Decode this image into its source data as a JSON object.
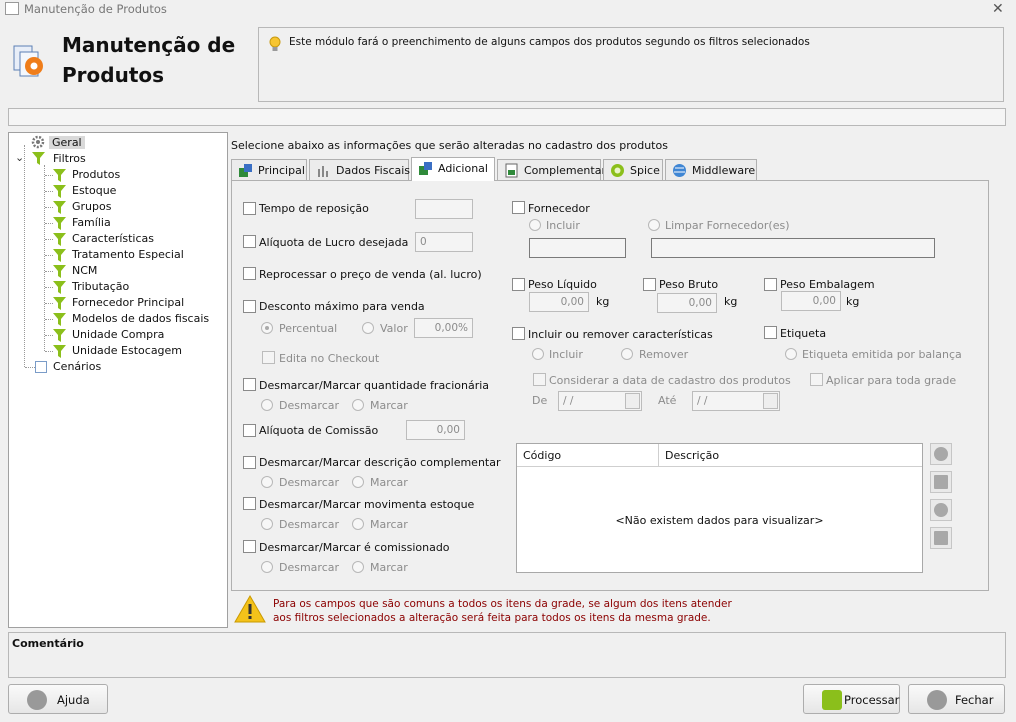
{
  "window": {
    "title": "Manutenção de Produtos",
    "close_glyph": "✕"
  },
  "header": {
    "title_line1": "Manutenção de",
    "title_line2": "Produtos",
    "info": "Este módulo fará o preenchimento de alguns campos dos produtos segundo os filtros selecionados"
  },
  "tree": {
    "root": "Geral",
    "filters_label": "Filtros",
    "filters": [
      "Produtos",
      "Estoque",
      "Grupos",
      "Família",
      "Características",
      "Tratamento Especial",
      "NCM",
      "Tributação",
      "Fornecedor Principal",
      "Modelos de dados fiscais",
      "Unidade Compra",
      "Unidade Estocagem"
    ],
    "scenarios": "Cenários"
  },
  "main": {
    "caption": "Selecione abaixo as informações que serão alteradas no cadastro dos produtos",
    "tabs": [
      {
        "label": "Principal"
      },
      {
        "label": "Dados Fiscais"
      },
      {
        "label": "Adicional"
      },
      {
        "label": "Complementar"
      },
      {
        "label": "Spice"
      },
      {
        "label": "Middleware"
      }
    ],
    "active_tab": "Adicional"
  },
  "left_form": {
    "tempo_reposicao": "Tempo de reposição",
    "tempo_reposicao_value": "",
    "aliquota_lucro": "Alíquota de Lucro desejada",
    "aliquota_lucro_value": "0",
    "reprocessar": "Reprocessar o preço de venda (al. lucro)",
    "desconto": "Desconto máximo para venda",
    "percentual": "Percentual",
    "valor": "Valor",
    "desconto_value": "0,00%",
    "edita_checkout": "Edita no Checkout",
    "qtd_fracionaria": "Desmarcar/Marcar quantidade fracionária",
    "desmarcar": "Desmarcar",
    "marcar": "Marcar",
    "aliquota_comissao": "Alíquota de Comissão",
    "aliquota_comissao_value": "0,00",
    "descricao_complementar": "Desmarcar/Marcar descrição complementar",
    "movimenta_estoque": "Desmarcar/Marcar movimenta estoque",
    "comissionado": "Desmarcar/Marcar é comissionado"
  },
  "right_form": {
    "fornecedor": "Fornecedor",
    "incluir": "Incluir",
    "limpar_fornecedores": "Limpar Fornecedor(es)",
    "peso_liquido": "Peso Líquido",
    "peso_bruto": "Peso Bruto",
    "peso_embalagem": "Peso Embalagem",
    "peso_value": "0,00",
    "kg": "kg",
    "caracteristicas": "Incluir ou remover características",
    "remover": "Remover",
    "etiqueta": "Etiqueta",
    "etiqueta_balanca": "Etiqueta emitida por balança",
    "considerar_data": "Considerar a data de cadastro dos produtos",
    "aplicar_grade": "Aplicar para toda grade",
    "de": "De",
    "ate": "Até",
    "date_placeholder": "/ /"
  },
  "grid": {
    "columns": [
      "Código",
      "Descrição"
    ],
    "empty": "<Não existem dados para visualizar>"
  },
  "warning": {
    "line1": "Para os campos que são comuns a todos os itens da grade, se algum dos itens atender",
    "line2": "aos filtros selecionados a alteração será feita para todos os itens da mesma grade."
  },
  "comment": {
    "label": "Comentário"
  },
  "footer": {
    "help": "Ajuda",
    "process": "Processar",
    "close": "Fechar"
  }
}
